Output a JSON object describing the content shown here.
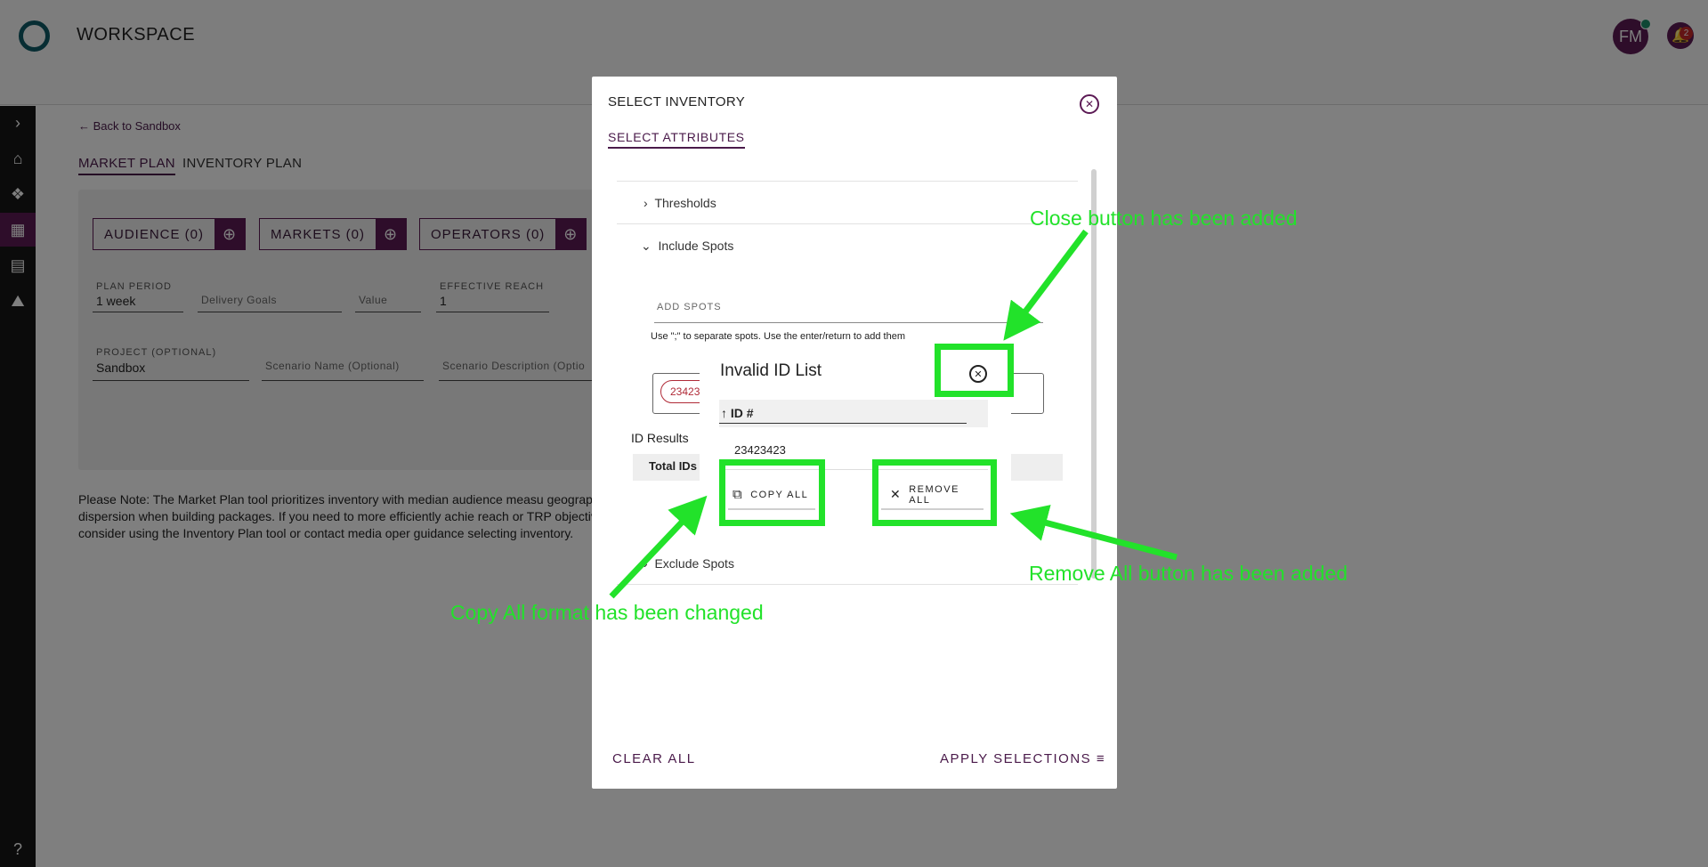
{
  "app": {
    "title": "WORKSPACE",
    "avatar_initials": "FM",
    "notification_count": "2"
  },
  "sidebar": {
    "items": [
      "expand",
      "home",
      "explore",
      "apps",
      "reports",
      "vehicles",
      "help"
    ]
  },
  "main": {
    "back_link": "Back to Sandbox",
    "tabs": [
      "MARKET PLAN",
      "INVENTORY PLAN"
    ],
    "chips": [
      "AUDIENCE (0)",
      "MARKETS (0)",
      "OPERATORS (0)"
    ],
    "plan_period_label": "PLAN PERIOD",
    "plan_period_value": "1 week",
    "delivery_goals": "Delivery Goals",
    "value_placeholder": "Value",
    "effective_reach_label": "EFFECTIVE REACH",
    "effective_reach_value": "1",
    "project_label": "PROJECT (OPTIONAL)",
    "project_value": "Sandbox",
    "scenario_name": "Scenario Name (Optional)",
    "scenario_description": "Scenario Description (Optio",
    "note": "Please Note: The Market Plan tool prioritizes inventory with median audience measu geographic dispersion when building packages. If you need to more efficiently achie reach or TRP objective, consider using the Inventory Plan tool or contact media oper guidance selecting inventory."
  },
  "modal": {
    "title": "SELECT INVENTORY",
    "tab": "SELECT ATTRIBUTES",
    "sections": {
      "thresholds": "Thresholds",
      "include_spots": "Include Spots",
      "exclude_spots": "Exclude Spots"
    },
    "add_spots_label": "ADD SPOTS",
    "hint": "Use \";\" to separate spots. Use the enter/return to add them",
    "spot_chip": "23423",
    "id_results": "ID Results",
    "total_ids": "Total IDs",
    "clear_all": "CLEAR ALL",
    "apply": "APPLY SELECTIONS"
  },
  "dialog": {
    "title": "Invalid ID List",
    "column": "ID #",
    "ids": [
      "23423423"
    ],
    "copy_all": "COPY ALL",
    "remove_all": "REMOVE ALL"
  },
  "annotations": {
    "close": "Close button has been added",
    "remove": "Remove All button has been added",
    "copy": "Copy All format has been changed",
    "color": "#22e22a"
  }
}
